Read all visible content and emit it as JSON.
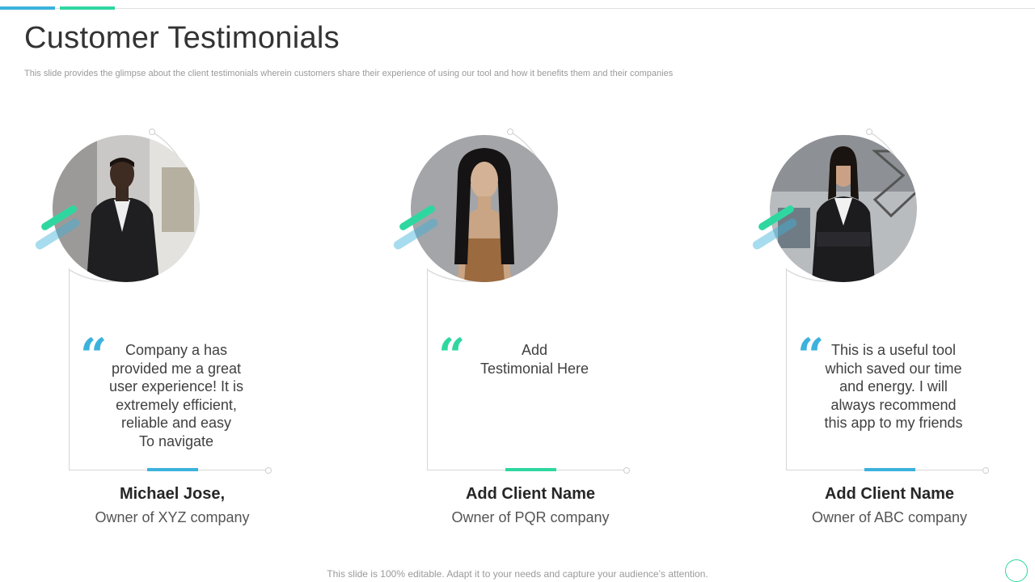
{
  "header": {
    "title": "Customer Testimonials",
    "subtitle": "This slide provides the glimpse about the client testimonials wherein customers share their experience of using our tool and how it benefits them and their companies"
  },
  "colors": {
    "blue": "#3cb2dc",
    "green": "#2fd7a0"
  },
  "testimonials": [
    {
      "quote": "Company a has\nprovided me a great\nuser experience! It is\nextremely efficient,\nreliable and easy\nTo navigate",
      "name": "Michael Jose,",
      "role": "Owner of XYZ company",
      "accent": "blue",
      "quote_icon": "quote-icon"
    },
    {
      "quote": "Add\nTestimonial Here",
      "name": "Add Client Name",
      "role": "Owner of PQR company",
      "accent": "green",
      "quote_icon": "quote-icon"
    },
    {
      "quote": "This is a useful tool\nwhich saved our time\nand energy. I will\nalways recommend\nthis app to my friends",
      "name": "Add Client Name",
      "role": "Owner of ABC company",
      "accent": "blue",
      "quote_icon": "quote-icon"
    }
  ],
  "footer": "This slide is 100% editable. Adapt it to your needs and capture your audience’s attention."
}
